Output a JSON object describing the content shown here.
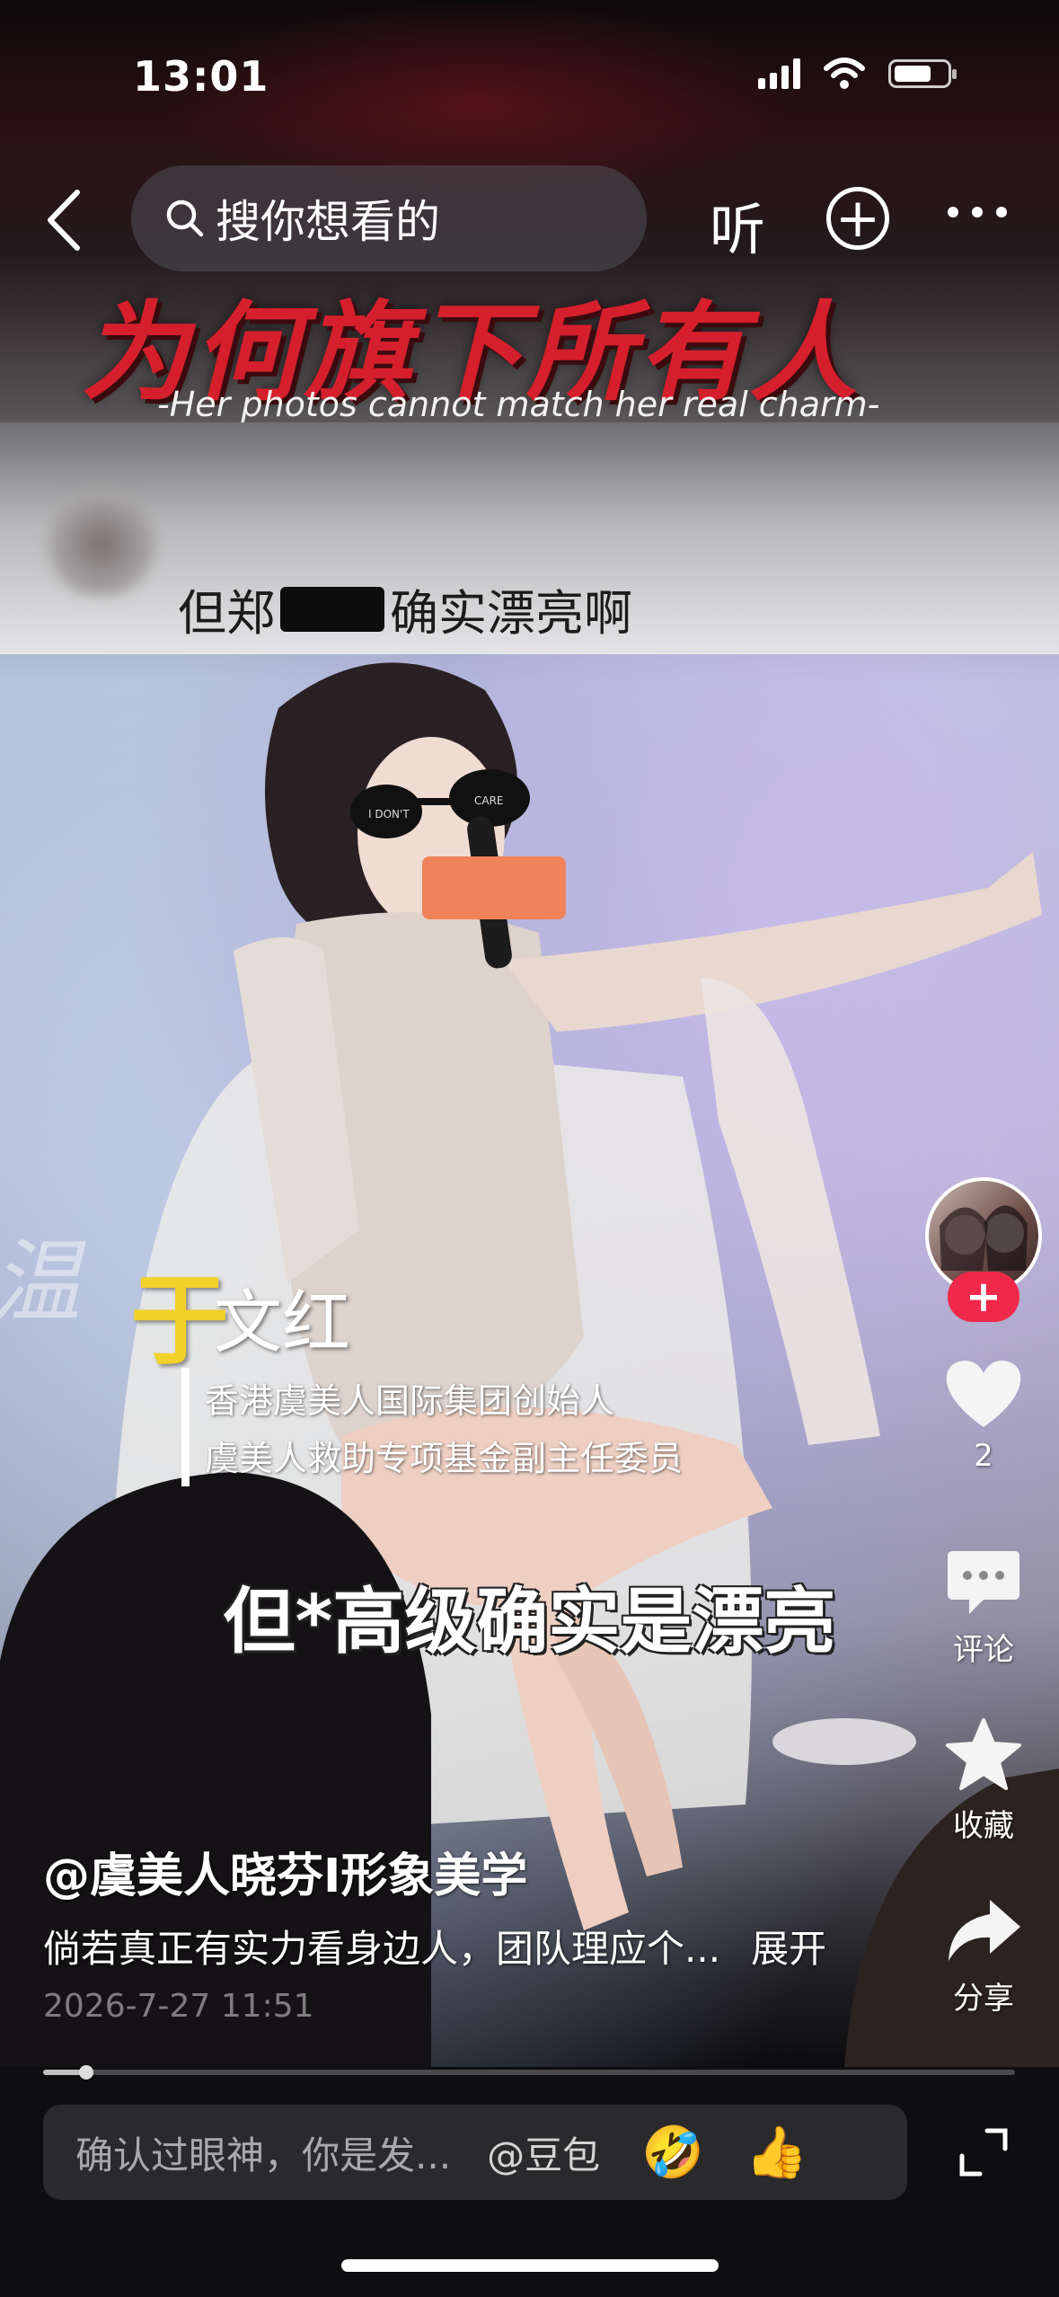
{
  "status_bar": {
    "time": "13:01"
  },
  "nav": {
    "search_placeholder": "搜你想看的",
    "listen_label": "听",
    "plus_label": "+"
  },
  "video": {
    "headline": "为何旗下所有人",
    "subhead": "-Her photos cannot match her real charm-",
    "comment_prefix": "但郑",
    "comment_suffix": "确实漂亮啊",
    "faint_script": "温",
    "name_yellow": "于",
    "name_white": "文红",
    "title_lines": [
      "香港虞美人国际集团创始人",
      "虞美人救助专项基金副主任委员"
    ],
    "caption": "但*高级确实是漂亮",
    "sunglasses_text": "I DON'T CARE"
  },
  "rail": {
    "follow_label": "+",
    "like_count": "2",
    "comment_label": "评论",
    "favorite_label": "收藏",
    "share_label": "分享"
  },
  "post": {
    "author": "@虞美人晓芬I形象美学",
    "description": "倘若真正有实力看身边人，团队理应个...",
    "expand_label": "展开",
    "date": "2026-7-27 11:51"
  },
  "progress": {
    "fraction": 0.044
  },
  "bottom_bar": {
    "comment_placeholder": "确认过眼神，你是发...",
    "mention": "@豆包",
    "emoji_1": "🤣",
    "emoji_2": "👍"
  },
  "colors": {
    "headline_red": "#d61f2c",
    "name_yellow": "#f2d12a",
    "follow_red": "#f0284a"
  }
}
